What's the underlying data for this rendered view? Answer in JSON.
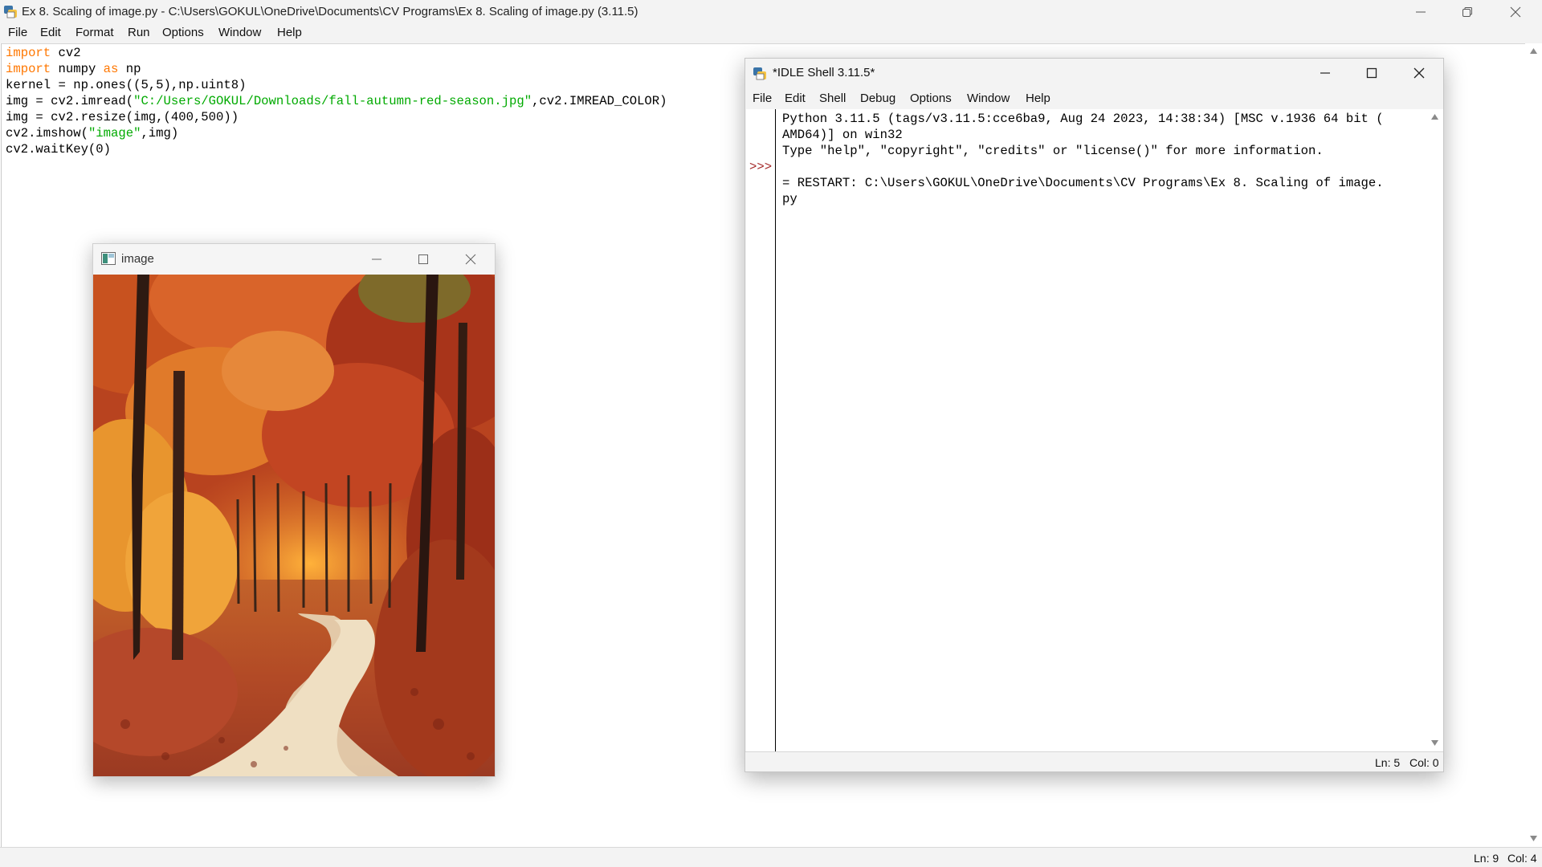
{
  "colors": {
    "keyword": "#ff7700",
    "string": "#00aa00",
    "prompt": "#a52a2a",
    "chrome": "#f3f3f3"
  },
  "editor": {
    "title": "Ex 8. Scaling of image.py - C:\\Users\\GOKUL\\OneDrive\\Documents\\CV Programs\\Ex 8. Scaling of image.py (3.11.5)",
    "icon": "python-idle-icon",
    "menu": [
      "File",
      "Edit",
      "Format",
      "Run",
      "Options",
      "Window",
      "Help"
    ],
    "code": {
      "l1_kw": "import",
      "l1_rest": " cv2",
      "l2_kw": "import",
      "l2_mid": " numpy ",
      "l2_kw2": "as",
      "l2_rest": " np",
      "l3": "kernel = np.ones((5,5),np.uint8)",
      "l4_pre": "img = cv2.imread(",
      "l4_str": "\"C:/Users/GOKUL/Downloads/fall-autumn-red-season.jpg\"",
      "l4_post": ",cv2.IMREAD_COLOR)",
      "l5": "img = cv2.resize(img,(400,500))",
      "l6_pre": "cv2.imshow(",
      "l6_str": "\"image\"",
      "l6_post": ",img)",
      "l7": "cv2.waitKey(0)"
    },
    "status": {
      "line": "Ln: 9",
      "col": "Col: 4"
    }
  },
  "image_window": {
    "title": "image",
    "icon": "opencv-window-icon",
    "content": "autumn forest path photo"
  },
  "shell": {
    "title": "*IDLE Shell 3.11.5*",
    "icon": "python-idle-icon",
    "menu": [
      "File",
      "Edit",
      "Shell",
      "Debug",
      "Options",
      "Window",
      "Help"
    ],
    "lines": [
      "Python 3.11.5 (tags/v3.11.5:cce6ba9, Aug 24 2023, 14:38:34) [MSC v.1936 64 bit (",
      "AMD64)] on win32",
      "Type \"help\", \"copyright\", \"credits\" or \"license()\" for more information.",
      "= RESTART: C:\\Users\\GOKUL\\OneDrive\\Documents\\CV Programs\\Ex 8. Scaling of image.",
      "py"
    ],
    "prompt": ">>>",
    "status": {
      "line": "Ln: 5",
      "col": "Col: 0"
    }
  }
}
